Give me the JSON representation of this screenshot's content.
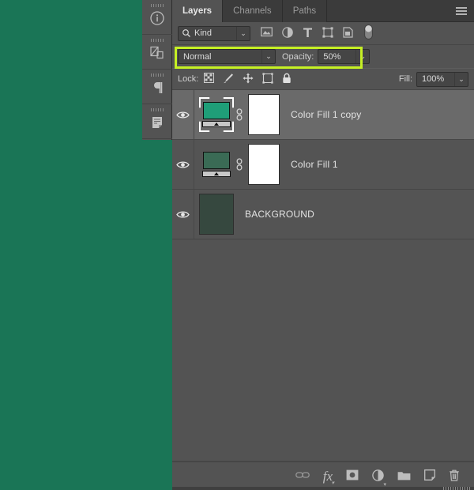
{
  "app": {
    "canvas_color": "#1a7556",
    "panel_bg": "#535353",
    "highlight_color": "#c6f024",
    "selected_row_bg": "#6a6a6a"
  },
  "dock": {
    "items": [
      {
        "name": "info-panel",
        "icon": "info-icon",
        "glyph": "i"
      },
      {
        "name": "layer-comps-panel",
        "icon": "layer-comps-icon",
        "glyph": ""
      },
      {
        "name": "paragraph-panel",
        "icon": "paragraph-icon",
        "glyph": "¶"
      },
      {
        "name": "notes-panel",
        "icon": "notes-icon",
        "glyph": ""
      }
    ]
  },
  "panel": {
    "tabs": [
      {
        "label": "Layers",
        "active": true
      },
      {
        "label": "Channels",
        "active": false
      },
      {
        "label": "Paths",
        "active": false
      }
    ],
    "menu_icon": "hamburger-menu-icon"
  },
  "filter": {
    "kind_label": "Kind",
    "search_icon": "search-icon",
    "caret": "⌄",
    "type_filters": [
      {
        "name": "filter-pixel-layers",
        "icon": "image-icon"
      },
      {
        "name": "filter-adjustment-layers",
        "icon": "adjustment-circle-icon"
      },
      {
        "name": "filter-type-layers",
        "icon": "text-T-icon"
      },
      {
        "name": "filter-shape-layers",
        "icon": "shape-icon"
      },
      {
        "name": "filter-smart-objects",
        "icon": "smart-object-icon"
      }
    ],
    "toggle": {
      "name": "filter-enable-toggle",
      "icon": "pill-toggle-icon"
    }
  },
  "blend": {
    "mode": "Normal",
    "opacity_label": "Opacity:",
    "opacity_value": "50%",
    "caret": "⌄",
    "highlighted": true
  },
  "lock": {
    "label": "Lock:",
    "icons": [
      {
        "name": "lock-transparent-pixels",
        "icon": "checkerboard-icon"
      },
      {
        "name": "lock-image-pixels",
        "icon": "brush-icon"
      },
      {
        "name": "lock-position",
        "icon": "move-arrows-icon"
      },
      {
        "name": "lock-artboard-nesting",
        "icon": "artboard-icon"
      },
      {
        "name": "lock-all",
        "icon": "padlock-icon"
      }
    ],
    "fill_label": "Fill:",
    "fill_value": "100%",
    "caret": "⌄"
  },
  "layers": [
    {
      "name": "Color Fill 1 copy",
      "visible": true,
      "selected": true,
      "thumb_type": "monitor",
      "thumb_color": "#1f9e78",
      "has_link": true,
      "has_mask": true,
      "mask_color": "#ffffff"
    },
    {
      "name": "Color Fill 1",
      "visible": true,
      "selected": false,
      "thumb_type": "monitor",
      "thumb_color": "#3a6b55",
      "has_link": true,
      "has_mask": true,
      "mask_color": "#ffffff"
    },
    {
      "name": "BACKGROUND",
      "visible": true,
      "selected": false,
      "thumb_type": "plain",
      "thumb_color": "#36483f",
      "has_link": false,
      "has_mask": false,
      "mask_color": ""
    }
  ],
  "bottom_bar": {
    "buttons": [
      {
        "name": "link-layers-button",
        "icon": "link-icon",
        "label": ""
      },
      {
        "name": "layer-styles-button",
        "icon": "fx-icon",
        "label": "fx"
      },
      {
        "name": "add-layer-mask-button",
        "icon": "mask-icon",
        "label": ""
      },
      {
        "name": "new-adjustment-layer-button",
        "icon": "adjustment-half-circle-icon",
        "label": ""
      },
      {
        "name": "new-group-button",
        "icon": "folder-icon",
        "label": ""
      },
      {
        "name": "new-layer-button",
        "icon": "new-layer-icon",
        "label": ""
      },
      {
        "name": "delete-layer-button",
        "icon": "trash-icon",
        "label": ""
      }
    ]
  }
}
